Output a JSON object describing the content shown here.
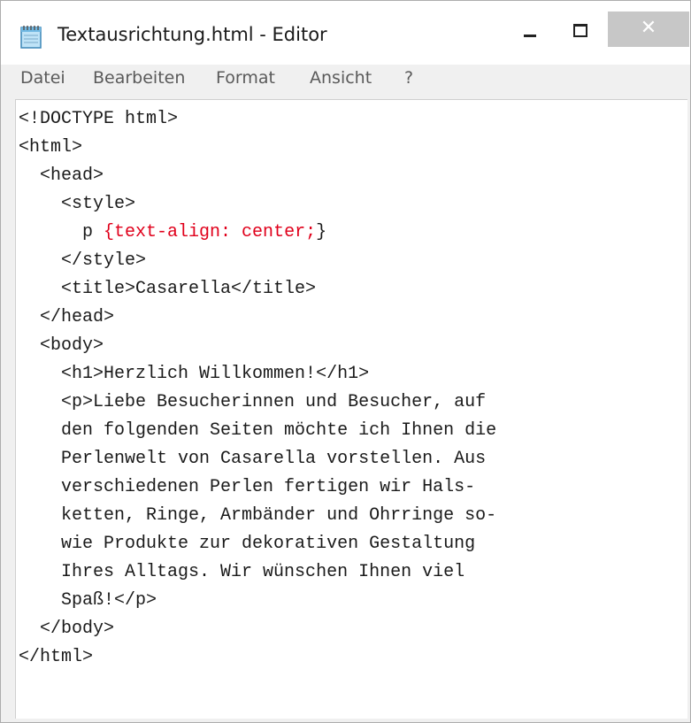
{
  "window": {
    "title": "Textausrichtung.html - Editor",
    "close_glyph": "✕",
    "icon": "notepad-icon"
  },
  "menu": {
    "items": [
      {
        "label": "Datei"
      },
      {
        "label": "Bearbeiten"
      },
      {
        "label": "Format"
      },
      {
        "label": "Ansicht"
      },
      {
        "label": "?"
      }
    ]
  },
  "editor": {
    "lines": [
      {
        "indent": "",
        "text": "<!DOCTYPE html>"
      },
      {
        "indent": "",
        "text": "<html>"
      },
      {
        "indent": "  ",
        "text": "<head>"
      },
      {
        "indent": "    ",
        "text": "<style>"
      },
      {
        "indent": "      ",
        "text": "p ",
        "highlight": "{text-align: center;",
        "rest": "}"
      },
      {
        "indent": "    ",
        "text": "</style>"
      },
      {
        "indent": "    ",
        "text": "<title>Casarella</title>"
      },
      {
        "indent": "  ",
        "text": "</head>"
      },
      {
        "indent": "  ",
        "text": "<body>"
      },
      {
        "indent": "    ",
        "text": "<h1>Herzlich Willkommen!</h1>"
      },
      {
        "indent": "    ",
        "text": "<p>Liebe Besucherinnen und Besucher, auf"
      },
      {
        "indent": "    ",
        "text": "den folgenden Seiten möchte ich Ihnen die"
      },
      {
        "indent": "    ",
        "text": "Perlenwelt von Casarella vorstellen. Aus"
      },
      {
        "indent": "    ",
        "text": "verschiedenen Perlen fertigen wir Hals-"
      },
      {
        "indent": "    ",
        "text": "ketten, Ringe, Armbänder und Ohrringe so-"
      },
      {
        "indent": "    ",
        "text": "wie Produkte zur dekorativen Gestaltung"
      },
      {
        "indent": "    ",
        "text": "Ihres Alltags. Wir wünschen Ihnen viel"
      },
      {
        "indent": "    ",
        "text": "Spaß!</p>"
      },
      {
        "indent": "  ",
        "text": "</body>"
      },
      {
        "indent": "",
        "text": "</html>"
      }
    ]
  },
  "colors": {
    "highlight_red": "#e0001b",
    "close_button_bg": "#c7c7c7",
    "chrome_bg": "#f0f0f0"
  }
}
